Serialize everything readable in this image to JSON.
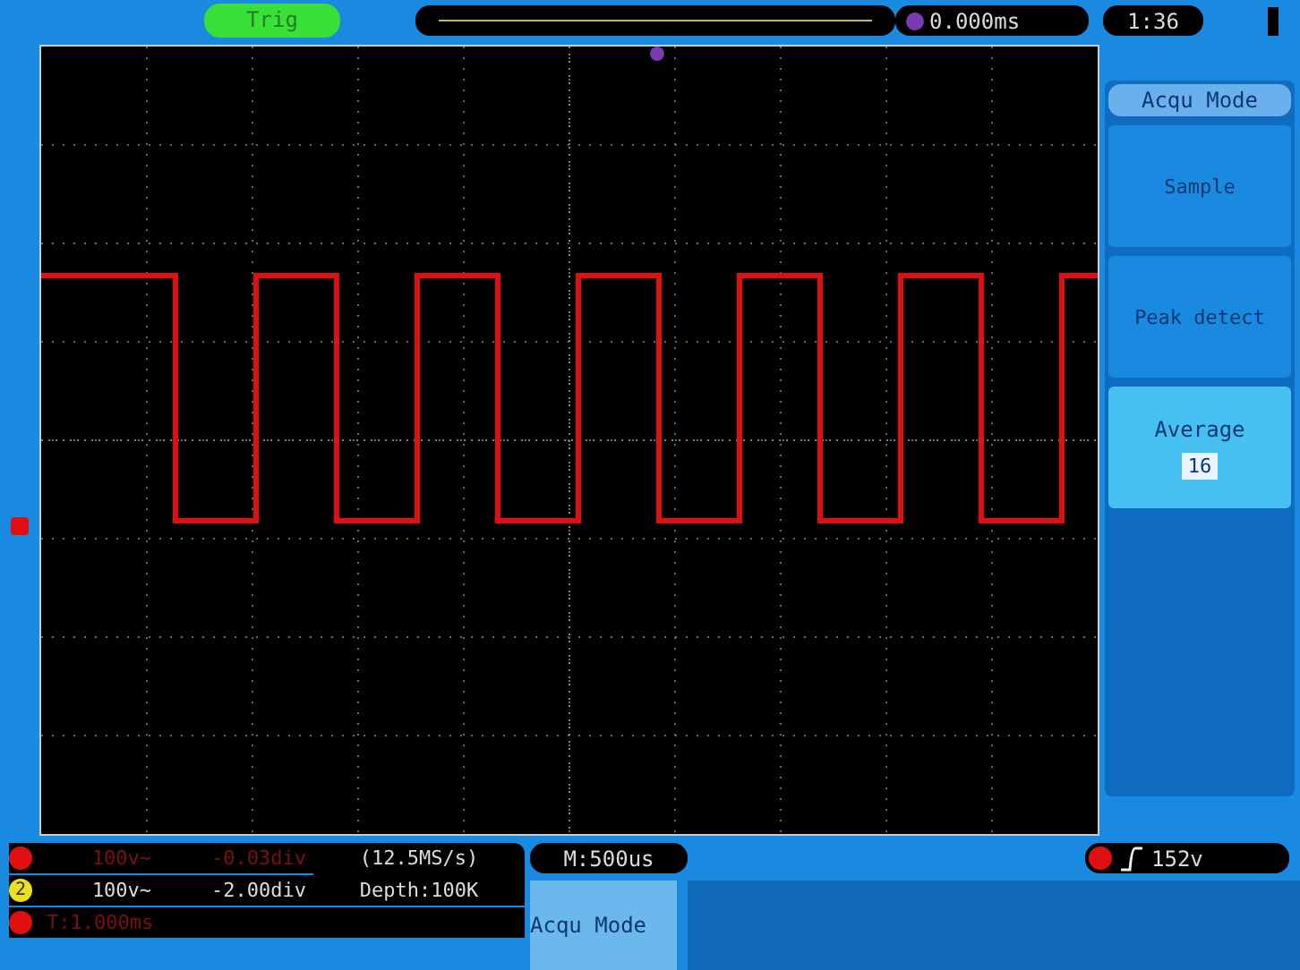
{
  "top_bar": {
    "trigger_status": "Trig",
    "time_offset": "0.000ms",
    "clock": "1:36"
  },
  "menu": {
    "title": "Acqu Mode",
    "items": [
      {
        "label": "Sample",
        "selected": false
      },
      {
        "label": "Peak detect",
        "selected": false
      },
      {
        "label": "Average",
        "selected": true,
        "value": "16"
      }
    ]
  },
  "channels": [
    {
      "scale": "100v~",
      "offset": "-0.03div",
      "color": "#e01010"
    },
    {
      "scale": "100v~",
      "offset": "-2.00div",
      "color": "#e8e020",
      "number": "2"
    }
  ],
  "sample_rate": "(12.5MS/s)",
  "depth": "Depth:100K",
  "trigger_time": "T:1.000ms",
  "timebase": "M:500us",
  "active_menu": "Acqu Mode",
  "trigger_level": "152v"
}
